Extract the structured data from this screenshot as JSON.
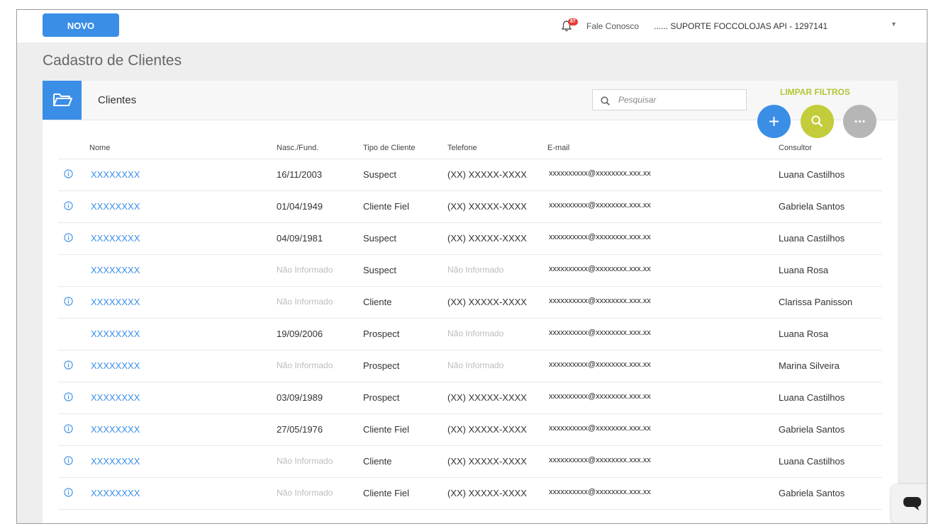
{
  "topbar": {
    "new_button": "NOVO",
    "notifications_count": "87",
    "contact_link": "Fale Conosco",
    "account_name": "...... SUPORTE FOCCOLOJAS API - 1297141"
  },
  "page": {
    "title": "Cadastro de Clientes"
  },
  "card": {
    "title": "Clientes",
    "search_placeholder": "Pesquisar",
    "clear_filters": "LIMPAR FILTROS"
  },
  "table": {
    "headers": {
      "name": "Nome",
      "birth": "Nasc./Fund.",
      "type": "Tipo de Cliente",
      "phone": "Telefone",
      "email": "E-mail",
      "consultant": "Consultor"
    },
    "rows": [
      {
        "info": true,
        "name": "XXXXXXXX",
        "birth": "16/11/2003",
        "type": "Suspect",
        "phone": "(XX) XXXXX-XXXX",
        "email": "xxxxxxxxxx@xxxxxxxx.xxx.xx",
        "consultant": "Luana Castilhos"
      },
      {
        "info": true,
        "name": "XXXXXXXX",
        "birth": "01/04/1949",
        "type": "Cliente Fiel",
        "phone": "(XX) XXXXX-XXXX",
        "email": "xxxxxxxxxx@xxxxxxxx.xxx.xx",
        "consultant": "Gabriela Santos"
      },
      {
        "info": true,
        "name": "XXXXXXXX",
        "birth": "04/09/1981",
        "type": "Suspect",
        "phone": "(XX) XXXXX-XXXX",
        "email": "xxxxxxxxxx@xxxxxxxx.xxx.xx",
        "consultant": "Luana Castilhos"
      },
      {
        "info": false,
        "name": "XXXXXXXX",
        "birth": "Não Informado",
        "type": "Suspect",
        "phone": "Não Informado",
        "email": "xxxxxxxxxx@xxxxxxxx.xxx.xx",
        "consultant": "Luana Rosa"
      },
      {
        "info": true,
        "name": "XXXXXXXX",
        "birth": "Não Informado",
        "type": "Cliente",
        "phone": "(XX) XXXXX-XXXX",
        "email": "xxxxxxxxxx@xxxxxxxx.xxx.xx",
        "consultant": "Clarissa Panisson"
      },
      {
        "info": false,
        "name": "XXXXXXXX",
        "birth": "19/09/2006",
        "type": "Prospect",
        "phone": "Não Informado",
        "email": "xxxxxxxxxx@xxxxxxxx.xxx.xx",
        "consultant": "Luana Rosa"
      },
      {
        "info": true,
        "name": "XXXXXXXX",
        "birth": "Não Informado",
        "type": "Prospect",
        "phone": "Não Informado",
        "email": "xxxxxxxxxx@xxxxxxxx.xxx.xx",
        "consultant": "Marina Silveira"
      },
      {
        "info": true,
        "name": "XXXXXXXX",
        "birth": "03/09/1989",
        "type": "Prospect",
        "phone": "(XX) XXXXX-XXXX",
        "email": "xxxxxxxxxx@xxxxxxxx.xxx.xx",
        "consultant": "Luana Castilhos"
      },
      {
        "info": true,
        "name": "XXXXXXXX",
        "birth": "27/05/1976",
        "type": "Cliente Fiel",
        "phone": "(XX) XXXXX-XXXX",
        "email": "xxxxxxxxxx@xxxxxxxx.xxx.xx",
        "consultant": "Gabriela Santos"
      },
      {
        "info": true,
        "name": "XXXXXXXX",
        "birth": "Não Informado",
        "type": "Cliente",
        "phone": "(XX) XXXXX-XXXX",
        "email": "xxxxxxxxxx@xxxxxxxx.xxx.xx",
        "consultant": "Luana Castilhos"
      },
      {
        "info": true,
        "name": "XXXXXXXX",
        "birth": "Não Informado",
        "type": "Cliente Fiel",
        "phone": "(XX) XXXXX-XXXX",
        "email": "xxxxxxxxxx@xxxxxxxx.xxx.xx",
        "consultant": "Gabriela Santos"
      }
    ]
  },
  "colors": {
    "accent_blue": "#3a8ee6",
    "accent_green": "#c3cc3a",
    "clear_filters": "#b5c435",
    "neutral_gray": "#b6b6b6",
    "badge_red": "#e53935"
  },
  "icons": {
    "bell": "bell-icon",
    "folder": "folder-open-icon",
    "search": "search-icon",
    "add": "plus-icon",
    "more": "more-icon",
    "info": "info-icon",
    "chat": "chat-icon",
    "dropdown": "caret-down-icon"
  }
}
